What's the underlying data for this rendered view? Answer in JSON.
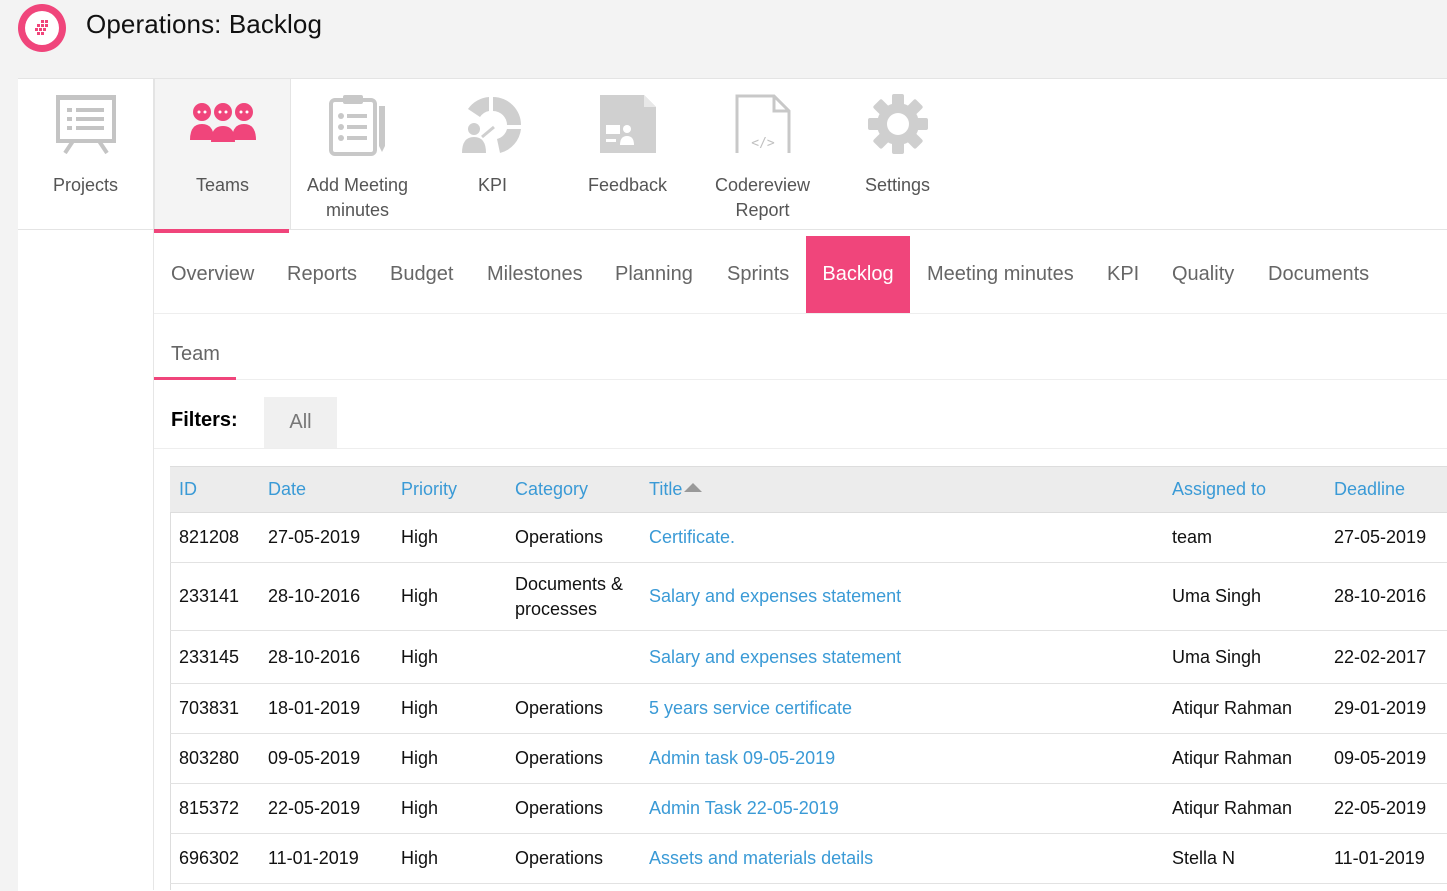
{
  "header": {
    "title": "Operations: Backlog",
    "accent_color": "#f0457b"
  },
  "nav": {
    "items": [
      {
        "label": "Projects",
        "icon": "presentation-board-icon"
      },
      {
        "label": "Teams",
        "icon": "team-people-icon"
      },
      {
        "label": "Add Meeting\nminutes",
        "icon": "clipboard-checklist-icon"
      },
      {
        "label": "KPI",
        "icon": "kpi-gauge-icon"
      },
      {
        "label": "Feedback",
        "icon": "feedback-document-icon"
      },
      {
        "label": "Codereview\nReport",
        "icon": "code-file-icon"
      },
      {
        "label": "Settings",
        "icon": "gear-icon"
      }
    ],
    "active": "Teams"
  },
  "subtabs": {
    "items": [
      "Overview",
      "Reports",
      "Budget",
      "Milestones",
      "Planning",
      "Sprints",
      "Backlog",
      "Meeting minutes",
      "KPI",
      "Quality",
      "Documents"
    ],
    "active": "Backlog"
  },
  "team_tab": {
    "label": "Team"
  },
  "filters": {
    "label": "Filters:",
    "chip": "All"
  },
  "table": {
    "columns": [
      "ID",
      "Date",
      "Priority",
      "Category",
      "Title",
      "Assigned to",
      "Deadline"
    ],
    "sorted_column": "Title",
    "rows": [
      [
        "821208",
        "27-05-2019",
        "High",
        "Operations",
        "Certificate.",
        "team",
        "27-05-2019"
      ],
      [
        "233141",
        "28-10-2016",
        "High",
        "Documents & processes",
        "Salary and expenses statement",
        "Uma Singh",
        "28-10-2016"
      ],
      [
        "233145",
        "28-10-2016",
        "High",
        "",
        "Salary and expenses statement",
        "Uma Singh",
        "22-02-2017"
      ],
      [
        "703831",
        "18-01-2019",
        "High",
        "Operations",
        "5 years service certificate",
        "Atiqur Rahman",
        "29-01-2019"
      ],
      [
        "803280",
        "09-05-2019",
        "High",
        "Operations",
        "Admin task 09-05-2019",
        "Atiqur Rahman",
        "09-05-2019"
      ],
      [
        "815372",
        "22-05-2019",
        "High",
        "Operations",
        "Admin Task 22-05-2019",
        "Atiqur Rahman",
        "22-05-2019"
      ],
      [
        "696302",
        "11-01-2019",
        "High",
        "Operations",
        "Assets and materials details",
        "Stella N",
        "11-01-2019"
      ]
    ]
  }
}
